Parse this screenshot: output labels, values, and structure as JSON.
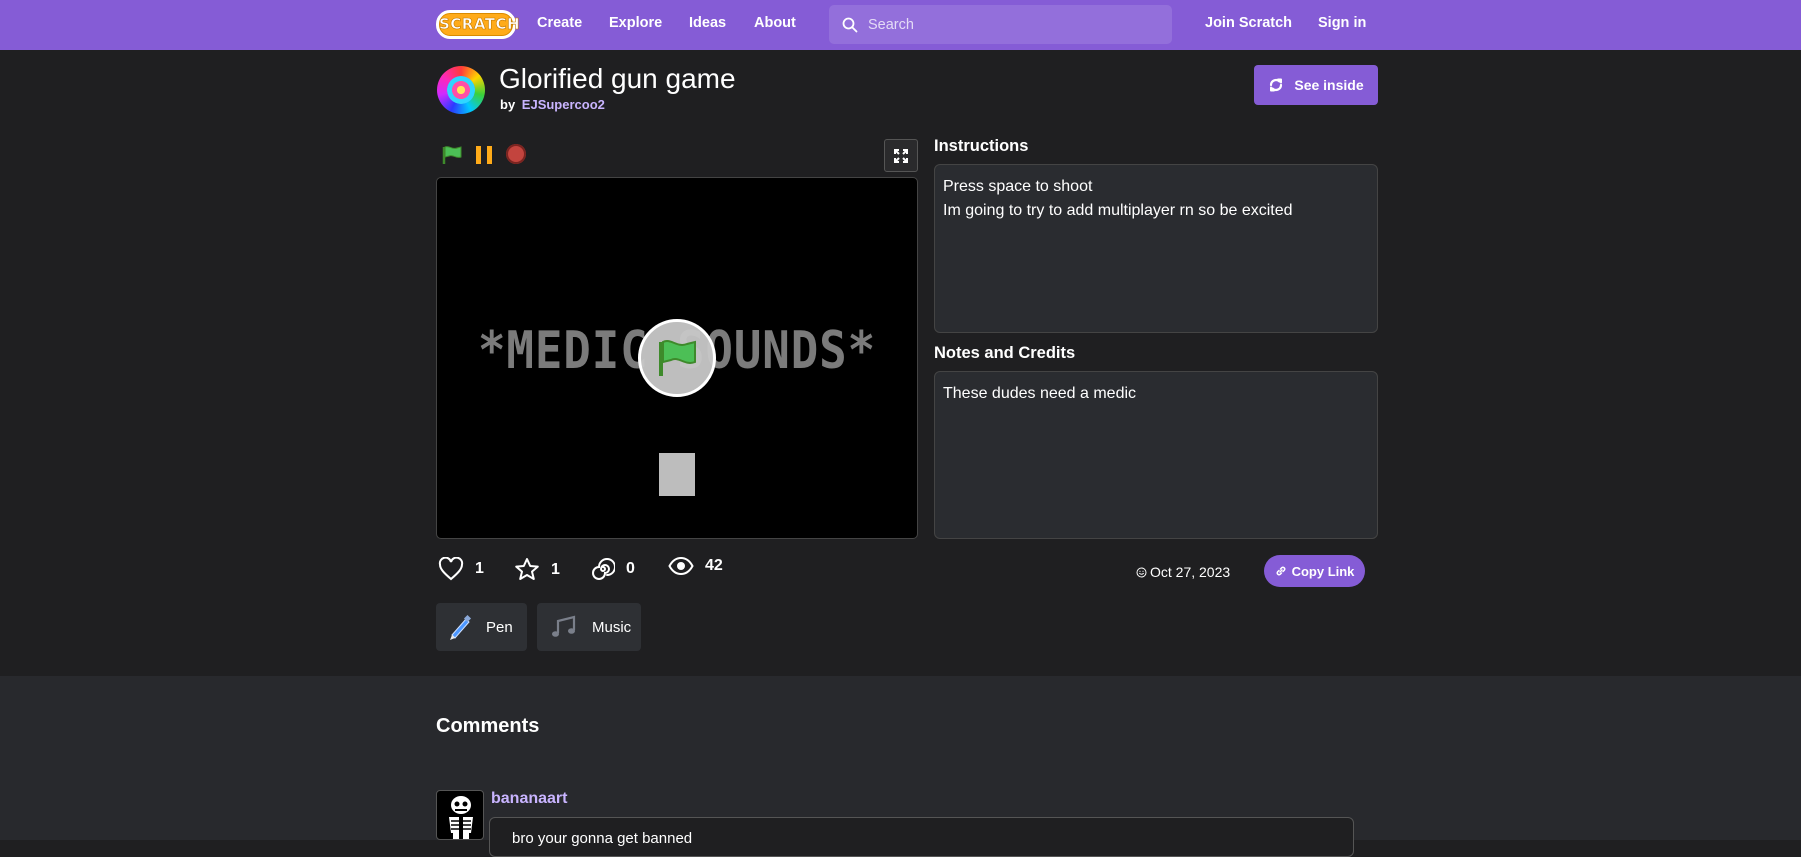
{
  "nav": {
    "logo_text": "SCRATCH",
    "links": [
      "Create",
      "Explore",
      "Ideas",
      "About"
    ],
    "search_placeholder": "Search",
    "join": "Join Scratch",
    "sign_in": "Sign in"
  },
  "project": {
    "title": "Glorified gun game",
    "by": "by",
    "author": "EJSupercoo2",
    "see_inside": "See inside"
  },
  "stage": {
    "text": "*MEDIC SOUNDS*"
  },
  "instructions": {
    "label": "Instructions",
    "line1": "Press space to shoot",
    "line2": "Im going to try to add multiplayer rn so be excited"
  },
  "notes": {
    "label": "Notes and Credits",
    "text": "These dudes need a medic"
  },
  "stats": {
    "loves": "1",
    "favorites": "1",
    "remixes": "0",
    "views": "42"
  },
  "meta": {
    "date": "Oct 27, 2023",
    "copy_link": "Copy Link"
  },
  "tags": [
    "Pen",
    "Music"
  ],
  "comments": {
    "title": "Comments",
    "items": [
      {
        "user": "bananaart",
        "text": "bro your gonna get banned"
      }
    ]
  },
  "colors": {
    "accent": "#855cd6",
    "background": "#1f1f21",
    "link": "#c9b4ff"
  }
}
